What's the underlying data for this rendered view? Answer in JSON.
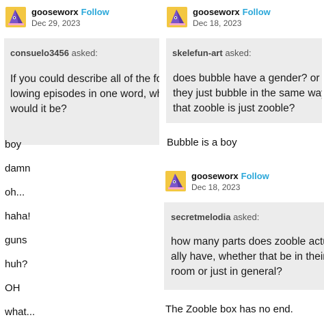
{
  "posts": [
    {
      "author": "gooseworx",
      "follow_label": "Follow",
      "date": "Dec 29, 2023",
      "asker": "consuelo3456",
      "asked_label": "asked:",
      "question_lines": [
        "If you could describe all of the fol-",
        "lowing episodes in one word, what",
        "would it be?"
      ],
      "answers": [
        "boy",
        "damn",
        "oh...",
        "haha!",
        "guns",
        "huh?",
        "OH",
        "what..."
      ]
    },
    {
      "author": "gooseworx",
      "follow_label": "Follow",
      "date": "Dec 18, 2023",
      "asker": "skelefun-art",
      "asked_label": "asked:",
      "question_lines": [
        "does bubble have a gender? or are",
        "they just bubble in the same way",
        "that zooble is just zooble?"
      ],
      "answer": "Bubble is a boy"
    },
    {
      "author": "gooseworx",
      "follow_label": "Follow",
      "date": "Dec 18, 2023",
      "asker": "secretmelodia",
      "asked_label": "asked:",
      "question_lines": [
        "how many parts does zooble actu-",
        "ally have, whether that be in their",
        "room or just in general?"
      ],
      "answer": "The Zooble box has no end."
    }
  ]
}
